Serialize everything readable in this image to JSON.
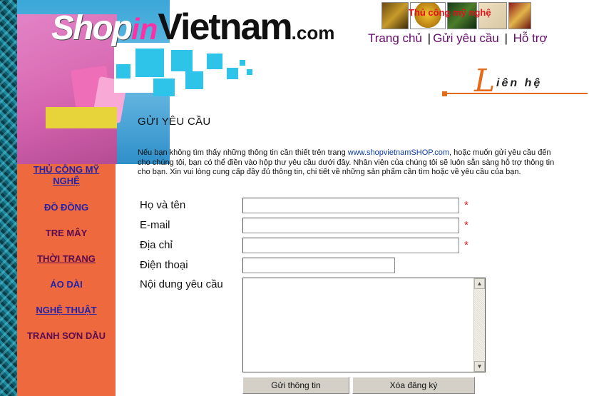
{
  "logo": {
    "shop": "Shop",
    "in": "in",
    "vietnam": "Vietnam",
    "com": ".com"
  },
  "header": {
    "thumb_caption": "Thủ công mỹ nghệ",
    "nav": [
      {
        "label": "Trang chủ"
      },
      {
        "label": "Gửi yêu cầu"
      },
      {
        "label": "Hỗ trợ"
      }
    ],
    "contact_initial": "L",
    "contact_rest": "iên hệ"
  },
  "sidebar": {
    "items": [
      {
        "label": "THỦ CÔNG MỸ NGHỆ"
      },
      {
        "label": "ĐỒ ĐỒNG"
      },
      {
        "label": "TRE MÂY"
      },
      {
        "label": "THỜI TRANG"
      },
      {
        "label": "ÁO DÀI"
      },
      {
        "label": "NGHỆ THUẬT"
      },
      {
        "label": "TRANH SƠN DẦU"
      }
    ]
  },
  "main": {
    "title": "GỬI YÊU CẦU",
    "intro_before": "Nếu bạn không tìm thấy những thông tin cần thiết trên trang ",
    "intro_link": "www.shopvietnamSHOP.com",
    "intro_after": ", hoặc muốn gửi yêu cầu đến cho chúng tôi, bạn có thể điền vào hộp thư yêu cầu dưới đây. Nhân viên của chúng tôi sẽ luôn sẵn sàng hỗ trợ thông tin cho bạn. Xin vui lòng cung cấp đầy đủ thông tin, chi tiết về những sản phẩm cần tìm hoặc về yêu cầu của bạn."
  },
  "form": {
    "name_label": "Họ và tên",
    "email_label": "E-mail",
    "address_label": "Địa chỉ",
    "phone_label": "Điện thoại",
    "content_label": "Nội dung yêu cầu",
    "required_mark": "*",
    "name_value": "",
    "email_value": "",
    "address_value": "",
    "phone_value": "",
    "content_value": "",
    "submit_label": "Gửi thông tin",
    "reset_label": "Xóa đăng ký",
    "scroll_up": "▲",
    "scroll_down": "▼"
  }
}
